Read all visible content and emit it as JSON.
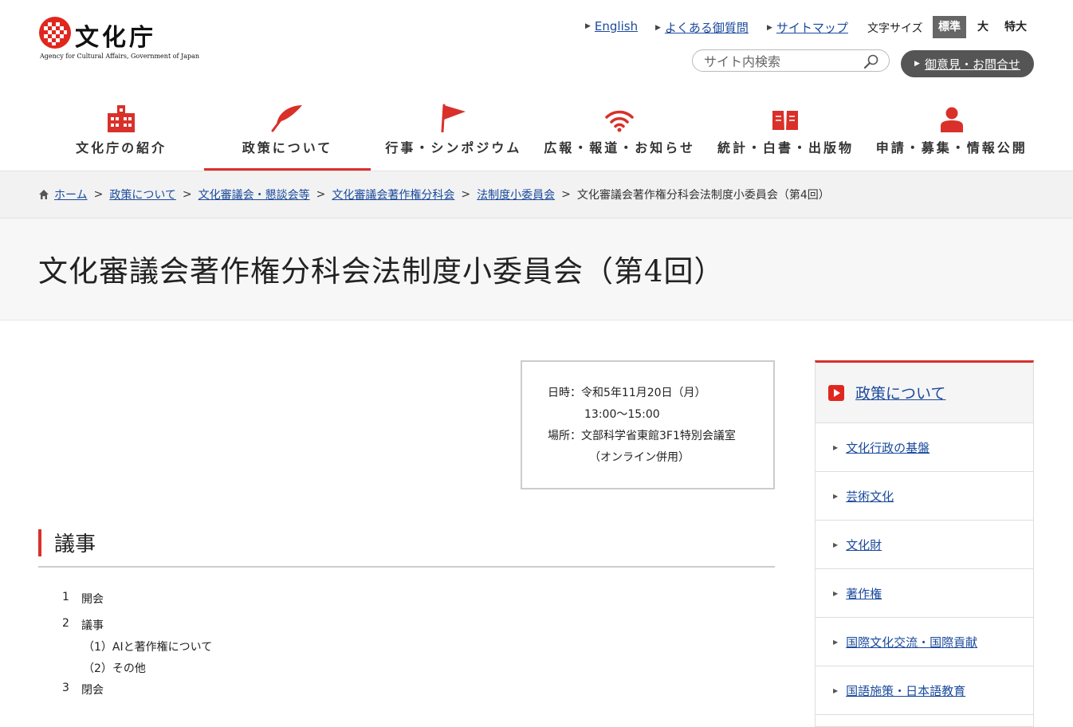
{
  "site": {
    "name_jp": "文化庁",
    "name_en": "Agency for Cultural Affairs, Government of Japan"
  },
  "header": {
    "links": [
      "English",
      "よくある御質問",
      "サイトマップ"
    ],
    "font_size_label": "文字サイズ",
    "font_sizes": [
      "標準",
      "大",
      "特大"
    ],
    "search_placeholder": "サイト内検索",
    "contact": "御意見・お問合せ"
  },
  "nav": [
    {
      "label": "文化庁の紹介",
      "icon": "building-icon"
    },
    {
      "label": "政策について",
      "icon": "quill-icon",
      "active": true
    },
    {
      "label": "行事・シンポジウム",
      "icon": "flag-icon"
    },
    {
      "label": "広報・報道・お知らせ",
      "icon": "wifi-icon"
    },
    {
      "label": "統計・白書・出版物",
      "icon": "book-icon"
    },
    {
      "label": "申請・募集・情報公開",
      "icon": "person-icon"
    }
  ],
  "breadcrumb": [
    "ホーム",
    "政策について",
    "文化審議会・懇談会等",
    "文化審議会著作権分科会",
    "法制度小委員会",
    "文化審議会著作権分科会法制度小委員会（第4回）"
  ],
  "page_title": "文化審議会著作権分科会法制度小委員会（第4回）",
  "meeting": {
    "date_line": "日時：令和5年11月20日（月）",
    "time_line": "13:00～15:00",
    "place_line": "場所：文部科学省東館3F1特別会議室",
    "place_note": "（オンライン併用）"
  },
  "agenda": {
    "heading": "議事",
    "items": [
      {
        "num": "1",
        "text": "開会"
      },
      {
        "num": "2",
        "text": "議事"
      },
      {
        "num": "3",
        "text": "閉会"
      }
    ],
    "subitems": [
      "（1）AIと著作権について",
      "（2）その他"
    ]
  },
  "sidebar": {
    "title": "政策について",
    "items": [
      "文化行政の基盤",
      "芸術文化",
      "文化財",
      "著作権",
      "国際文化交流・国際貢献",
      "国語施策・日本語教育"
    ]
  },
  "colors": {
    "accent": "#d9302a",
    "link": "#1a4a9c"
  }
}
